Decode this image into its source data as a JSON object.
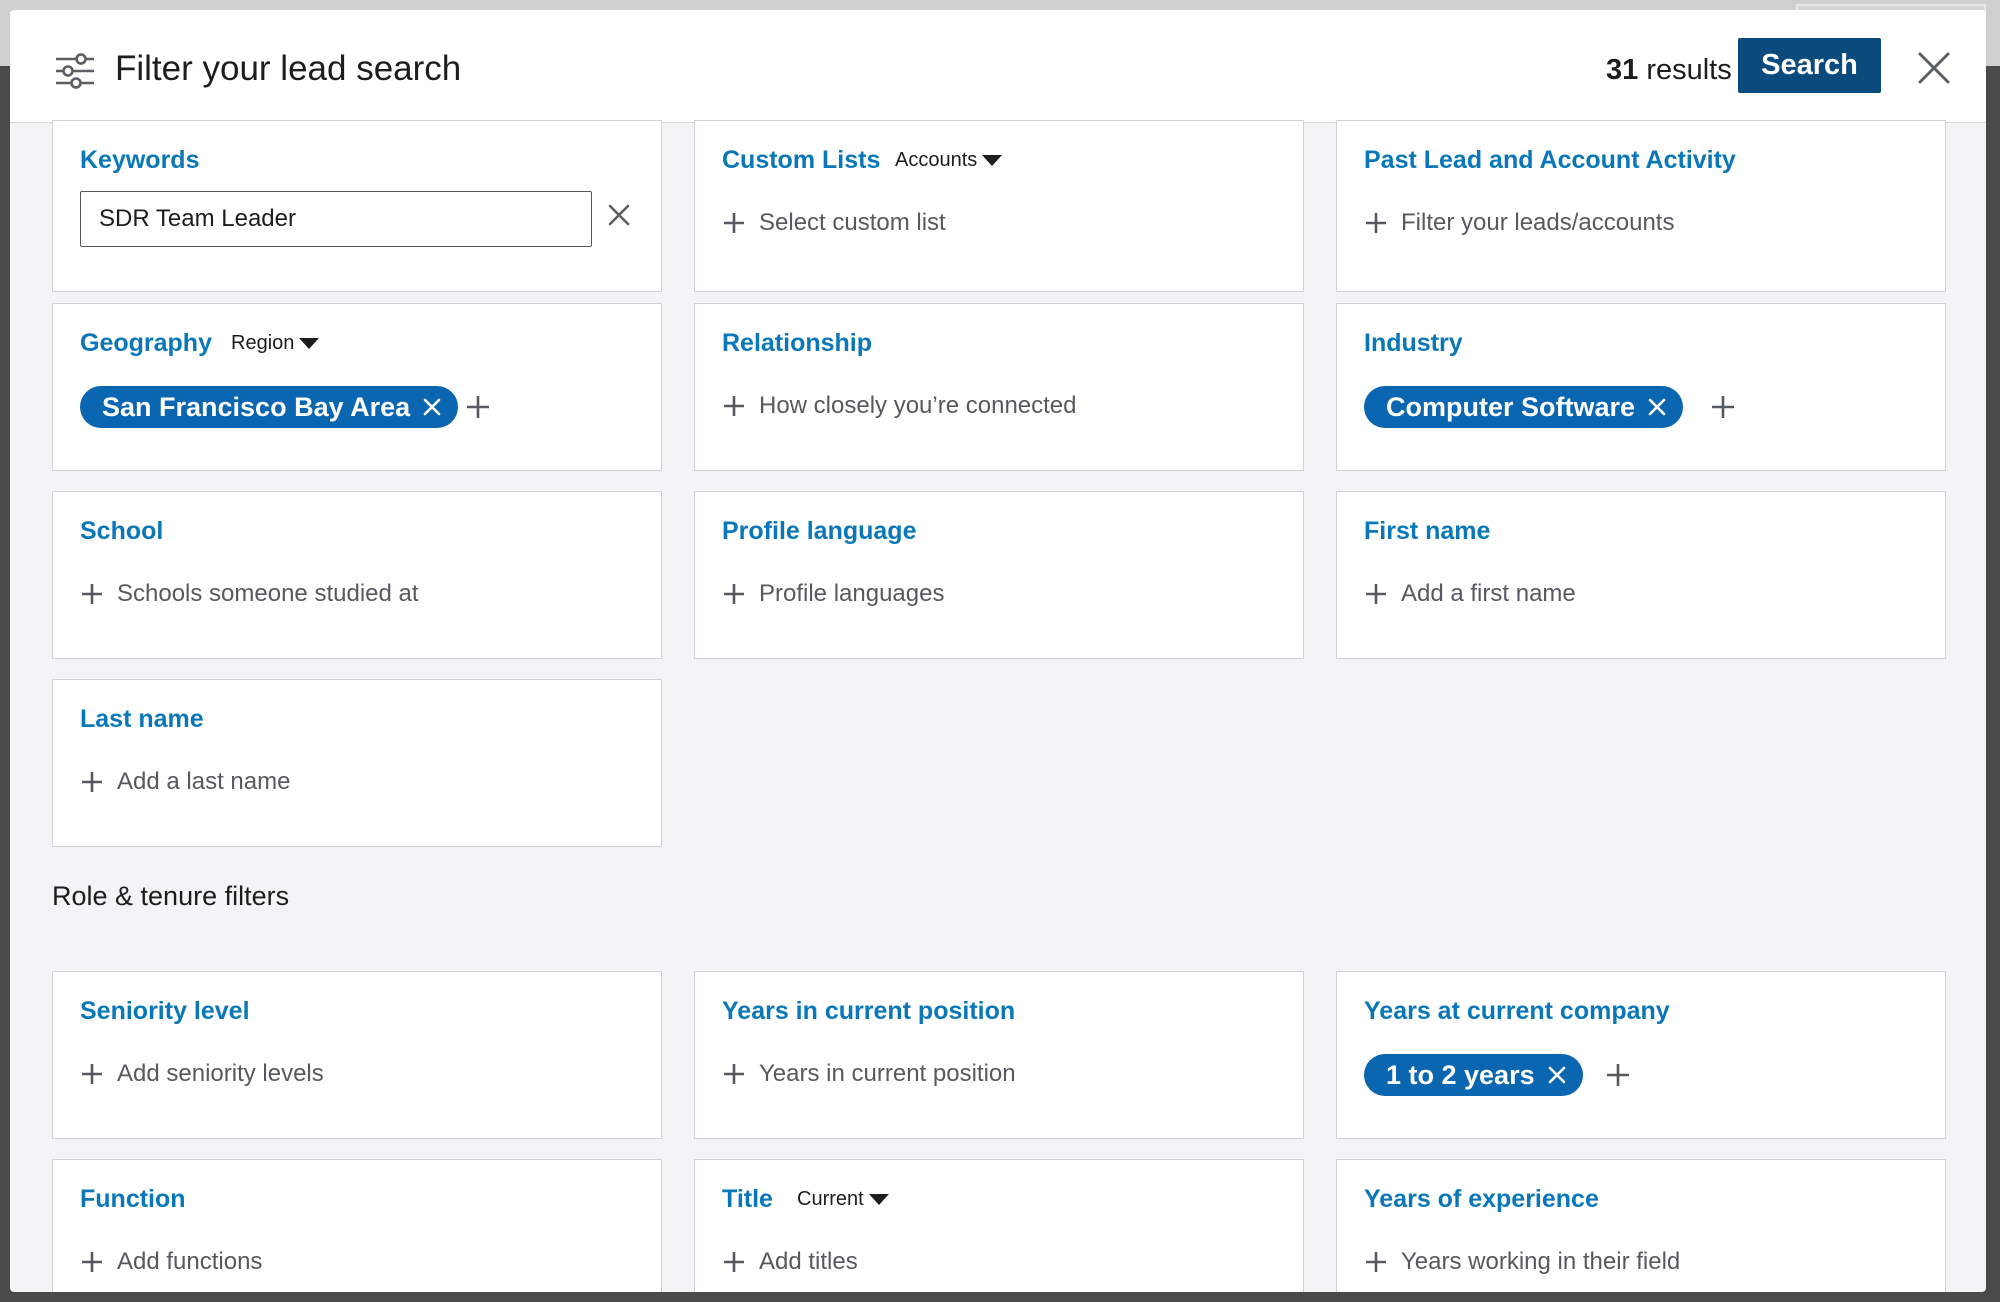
{
  "header": {
    "title": "Filter your lead search",
    "results_count": "31",
    "results_label": "results",
    "search_label": "Search"
  },
  "icons": {
    "filter": "sliders-icon",
    "close": "close-icon",
    "plus": "plus-icon",
    "remove": "x-icon",
    "caret": "caret-down-icon"
  },
  "colors": {
    "accent": "#0a78b8",
    "primary_button": "#0a4a7c",
    "pill": "#0a66b0"
  },
  "filters": {
    "keywords": {
      "title": "Keywords",
      "value": "SDR Team Leader"
    },
    "custom_lists": {
      "title": "Custom Lists",
      "dropdown": "Accounts",
      "placeholder": "Select custom list"
    },
    "past_activity": {
      "title": "Past Lead and Account Activity",
      "placeholder": "Filter your leads/accounts"
    },
    "geography": {
      "title": "Geography",
      "dropdown": "Region",
      "selected": "San Francisco Bay Area"
    },
    "relationship": {
      "title": "Relationship",
      "placeholder": "How closely you’re connected"
    },
    "industry": {
      "title": "Industry",
      "selected": "Computer Software"
    },
    "school": {
      "title": "School",
      "placeholder": "Schools someone studied at"
    },
    "profile_language": {
      "title": "Profile language",
      "placeholder": "Profile languages"
    },
    "first_name": {
      "title": "First name",
      "placeholder": "Add a first name"
    },
    "last_name": {
      "title": "Last name",
      "placeholder": "Add a last name"
    }
  },
  "role_section": {
    "label": "Role & tenure filters",
    "seniority": {
      "title": "Seniority level",
      "placeholder": "Add seniority levels"
    },
    "years_position": {
      "title": "Years in current position",
      "placeholder": "Years in current position"
    },
    "years_company": {
      "title": "Years at current company",
      "selected": "1 to 2 years"
    },
    "function": {
      "title": "Function",
      "placeholder": "Add functions"
    },
    "title": {
      "title": "Title",
      "dropdown": "Current",
      "placeholder": "Add titles"
    },
    "years_experience": {
      "title": "Years of experience",
      "placeholder": "Years working in their field"
    }
  }
}
